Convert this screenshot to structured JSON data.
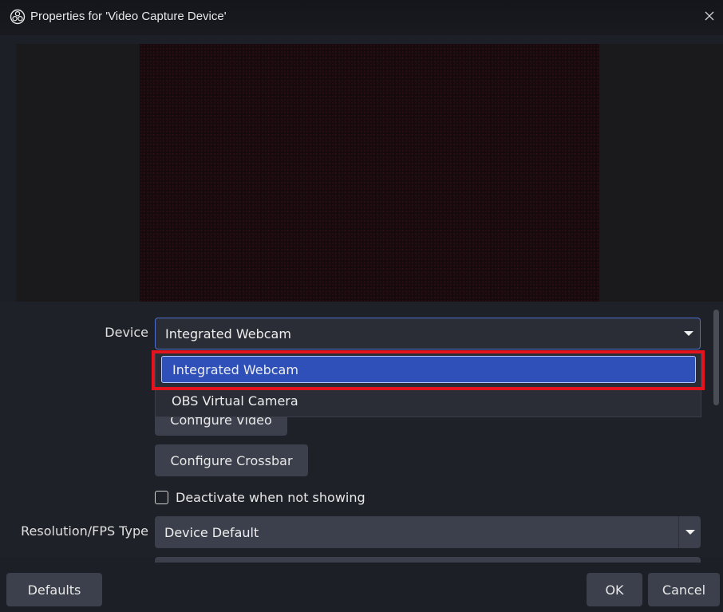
{
  "window": {
    "title": "Properties for 'Video Capture Device'",
    "close_glyph": "✕"
  },
  "form": {
    "device_label": "Device",
    "device_value": "Integrated Webcam",
    "configure_video_label": "Configure Video",
    "configure_crossbar_label": "Configure Crossbar",
    "deactivate_label": "Deactivate when not showing",
    "deactivate_checked": false,
    "resolution_label": "Resolution/FPS Type",
    "resolution_value": "Device Default"
  },
  "dropdown": {
    "items": [
      {
        "label": "Integrated Webcam",
        "selected": true
      },
      {
        "label": "OBS Virtual Camera",
        "selected": false
      }
    ]
  },
  "footer": {
    "defaults_label": "Defaults",
    "ok_label": "OK",
    "cancel_label": "Cancel"
  },
  "colors": {
    "background": "#1d1f26",
    "control": "#3c404c",
    "selection": "#2e50b8",
    "highlight_border": "#e3141d"
  }
}
